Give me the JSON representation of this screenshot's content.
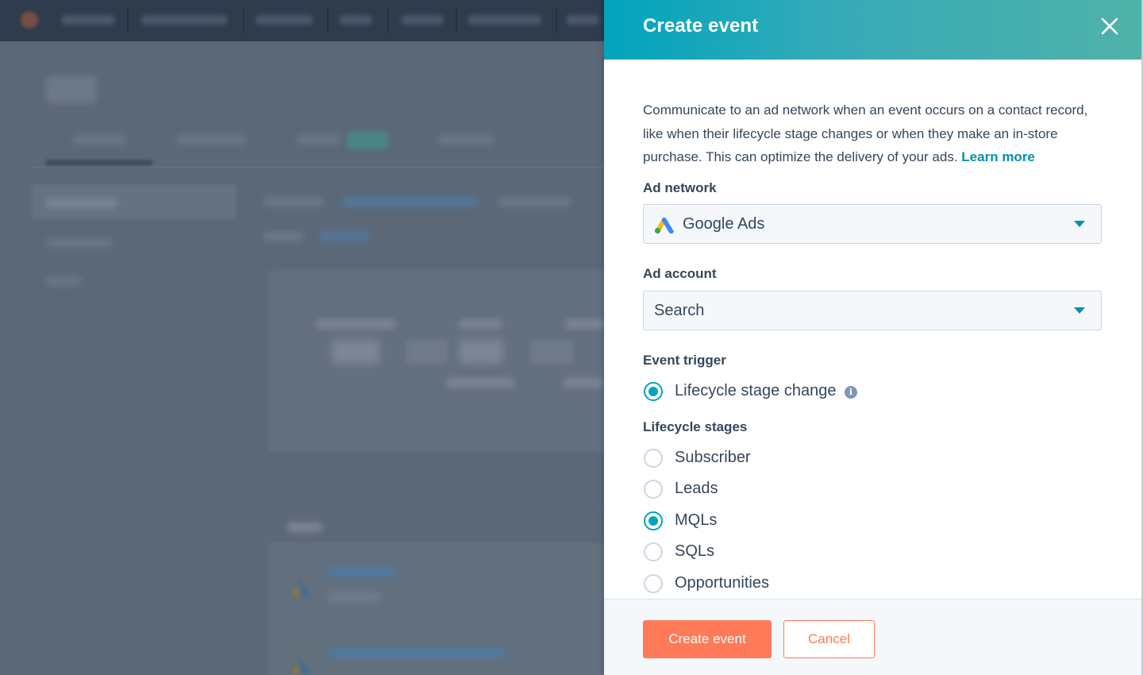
{
  "panel": {
    "title": "Create event",
    "close_icon": "close-icon",
    "description": "Communicate to an ad network when an event occurs on a contact record, like when their lifecycle stage changes or when they make an in-store purchase. This can optimize the delivery of your ads.",
    "learn_more": "Learn more"
  },
  "ad_network": {
    "label": "Ad network",
    "value": "Google Ads",
    "icon": "google-ads-icon"
  },
  "ad_account": {
    "label": "Ad account",
    "value": "Search"
  },
  "event_trigger": {
    "label": "Event trigger",
    "option": "Lifecycle stage change",
    "checked": true,
    "info_icon": "info-icon"
  },
  "lifecycle_stages": {
    "label": "Lifecycle stages",
    "options": [
      {
        "label": "Subscriber",
        "checked": false
      },
      {
        "label": "Leads",
        "checked": false
      },
      {
        "label": "MQLs",
        "checked": true
      },
      {
        "label": "SQLs",
        "checked": false
      },
      {
        "label": "Opportunities",
        "checked": false
      }
    ]
  },
  "footer": {
    "primary": "Create event",
    "secondary": "Cancel"
  },
  "colors": {
    "header_gradient_start": "#00a4bd",
    "header_gradient_end": "#4fb2a9",
    "primary_button": "#ff7a59",
    "link": "#0091ae",
    "radio_checked": "#00a4bd",
    "text": "#33475b",
    "overlay": "#5c6878"
  }
}
